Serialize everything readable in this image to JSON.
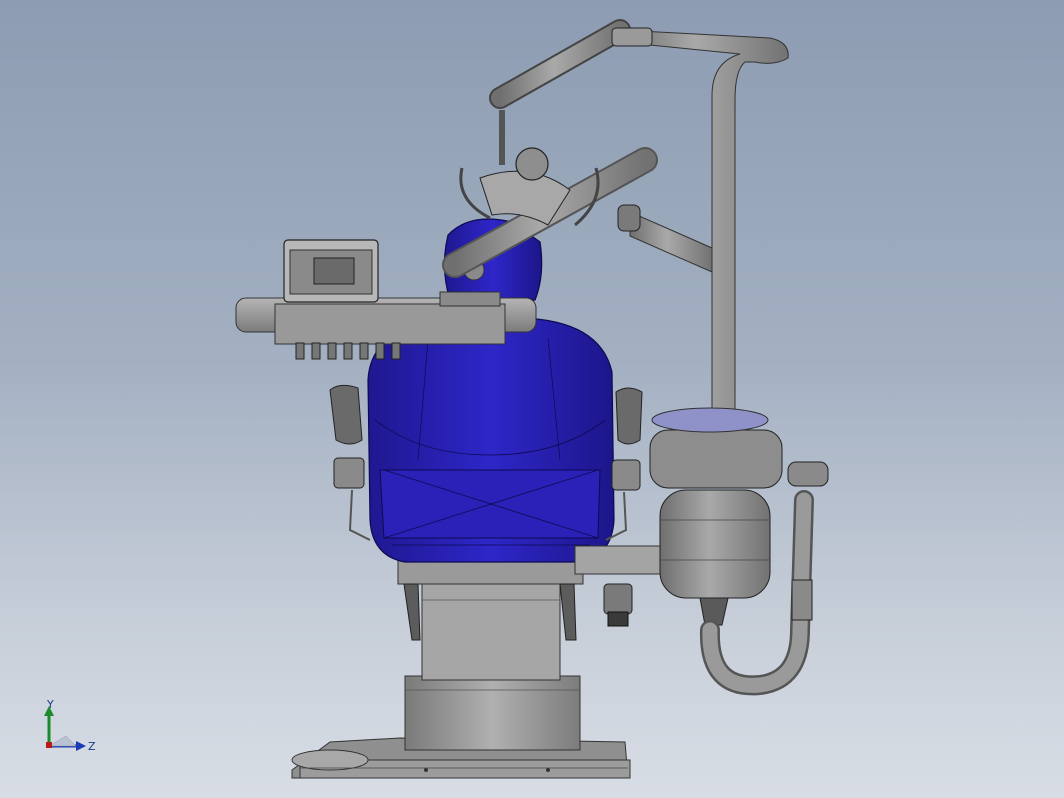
{
  "viewport": {
    "colors": {
      "background_top": "#8d9cb2",
      "background_bottom": "#d8dde5",
      "upholstery": "#2a22b8",
      "metal": "#8a8a8a"
    }
  },
  "triad": {
    "y_label": "Y",
    "z_label": "Z",
    "colors": {
      "y_axis": "#1a8a2a",
      "z_axis": "#1a3ab8",
      "x_axis": "#b81a1a"
    }
  }
}
